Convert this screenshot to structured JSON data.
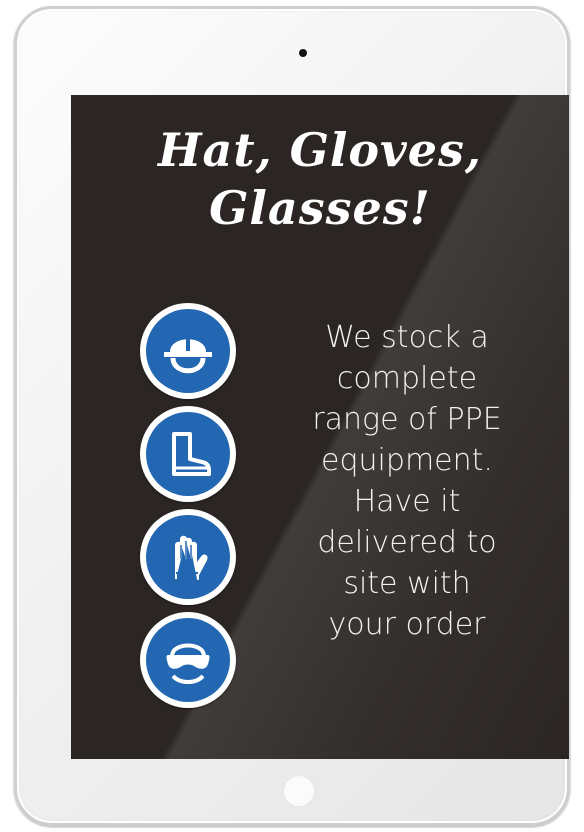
{
  "poster": {
    "headline": "Hat, Gloves,\nGlasses!",
    "body": "We stock a\ncomplete\nrange of PPE\nequipment.\nHave it\ndelivered to\nsite with\nyour order"
  },
  "icons": [
    {
      "name": "hard-hat-icon"
    },
    {
      "name": "safety-boot-icon"
    },
    {
      "name": "safety-glove-icon"
    },
    {
      "name": "safety-goggles-icon"
    }
  ],
  "colors": {
    "screen_background": "#2b2624",
    "sign_blue": "#2367b3",
    "text": "#ffffff",
    "device_frame": "#f1f1f1"
  }
}
